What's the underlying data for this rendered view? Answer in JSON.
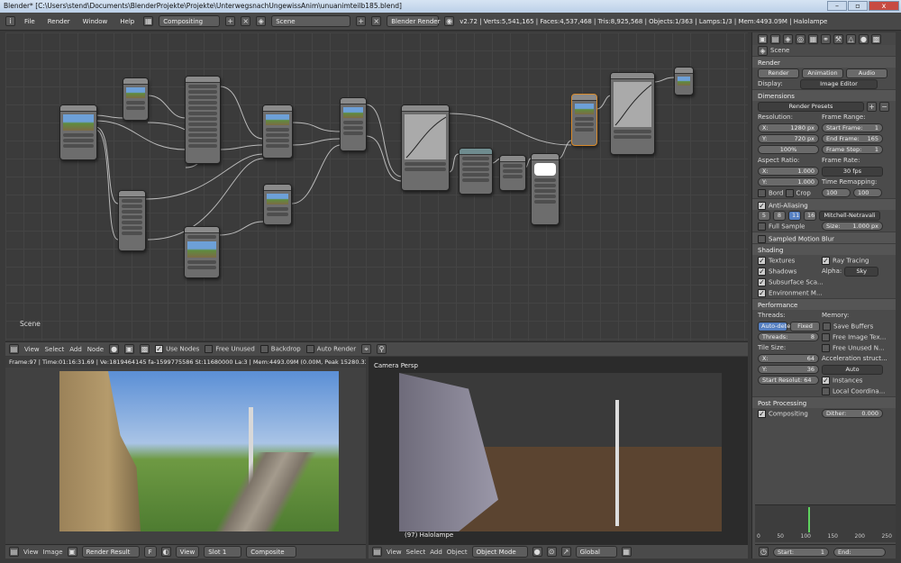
{
  "window": {
    "title": "Blender* [C:\\Users\\stend\\Documents\\BlenderProjekte\\Projekte\\UnterwegsnachUngewissAnim\\unuanimteilb185.blend]",
    "controls": [
      "–",
      "▫",
      "x"
    ]
  },
  "topbar": {
    "menus": [
      "File",
      "Render",
      "Window",
      "Help"
    ],
    "layout": "Compositing",
    "scene": "Scene",
    "engine": "Blender Render",
    "stats": "v2.72 | Verts:5,541,165 | Faces:4,537,468 | Tris:8,925,568 | Objects:1/363 | Lamps:1/3 | Mem:4493.09M | Halolampe"
  },
  "node_editor": {
    "scene_label": "Scene",
    "menu": [
      "View",
      "Select",
      "Add",
      "Node"
    ],
    "use_nodes": "Use Nodes",
    "free_unused": "Free Unused",
    "backdrop": "Backdrop",
    "auto_render": "Auto Render"
  },
  "image_editor": {
    "status": "Frame:97 | Time:01:16:31.69 | Ve:1819464145 fa-1599775586 St:11680000 La:3 | Mem:4493.09M (0.00M, Peak 15280.33M)",
    "menu": [
      "View",
      "Image"
    ],
    "image_name": "Render Result",
    "frame_field": "F",
    "view": "View",
    "slot": "Slot 1",
    "pass": "Composite"
  },
  "view3d": {
    "label": "Camera Persp",
    "object_label": "(97) Halolampe",
    "menu": [
      "View",
      "Select",
      "Add",
      "Object"
    ],
    "mode": "Object Mode",
    "orientation": "Global"
  },
  "properties": {
    "context": "Scene",
    "render": {
      "header": "Render",
      "buttons": [
        "Render",
        "Animation",
        "Audio"
      ],
      "display_label": "Display:",
      "display": "Image Editor"
    },
    "dimensions": {
      "header": "Dimensions",
      "presets": "Render Presets",
      "resolution_label": "Resolution:",
      "res_x": "X:",
      "res_x_val": "1280 px",
      "res_y": "Y:",
      "res_y_val": "720 px",
      "res_pct": "100%",
      "frame_range_label": "Frame Range:",
      "start": "Start Frame:",
      "start_val": "1",
      "end": "End Frame:",
      "end_val": "165",
      "step": "Frame Step:",
      "step_val": "1",
      "aspect_label": "Aspect Ratio:",
      "ax": "X:",
      "ax_val": "1.000",
      "ay": "Y:",
      "ay_val": "1.000",
      "framerate_label": "Frame Rate:",
      "fps": "30 fps",
      "remap_label": "Time Remapping:",
      "remap_old": "100",
      "remap_new": "100",
      "bord": "Bord",
      "crop": "Crop"
    },
    "aa": {
      "header": "Anti-Aliasing",
      "samples": [
        "5",
        "8",
        "11",
        "16"
      ],
      "filter": "Mitchell-Netravali",
      "full_sample": "Full Sample",
      "size": "Size:",
      "size_val": "1.000 px"
    },
    "motion_blur": {
      "header": "Sampled Motion Blur"
    },
    "shading": {
      "header": "Shading",
      "textures": "Textures",
      "ray_tracing": "Ray Tracing",
      "shadows": "Shadows",
      "alpha_label": "Alpha:",
      "alpha": "Sky",
      "sss": "Subsurface Sca...",
      "env": "Environment M..."
    },
    "performance": {
      "header": "Performance",
      "threads_label": "Threads:",
      "auto": "Auto-detec",
      "fixed": "Fixed",
      "threads": "Threads:",
      "threads_val": "8",
      "memory_label": "Memory:",
      "save_buffers": "Save Buffers",
      "free_image": "Free Image Tex...",
      "free_unused": "Free Unused N...",
      "tile_label": "Tile Size:",
      "tx": "X:",
      "tx_val": "64",
      "ty": "Y:",
      "ty_val": "36",
      "accel_label": "Acceleration struct...",
      "accel": "Auto",
      "instances": "Instances",
      "local": "Local Coordina...",
      "start_res": "Start Resolut: 64"
    },
    "post": {
      "header": "Post Processing",
      "compositing": "Compositing",
      "dither": "Dither:",
      "dither_val": "0.000"
    }
  },
  "timeline": {
    "ticks": [
      "0",
      "50",
      "100",
      "150",
      "200",
      "250"
    ],
    "start_label": "Start:",
    "start_val": "1",
    "end_label": "End:"
  }
}
